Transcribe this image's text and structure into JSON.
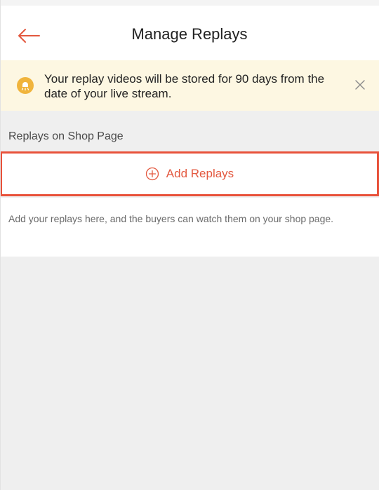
{
  "header": {
    "title": "Manage Replays"
  },
  "banner": {
    "text": "Your replay videos will be stored for 90 days from the date of your live stream.",
    "icon": "bell-icon"
  },
  "section": {
    "label": "Replays on Shop Page"
  },
  "add_button": {
    "label": "Add Replays"
  },
  "description": {
    "text": "Add your replays here, and the buyers can watch them on your shop page."
  },
  "colors": {
    "accent": "#e3583f",
    "banner_bg": "#fdf7e2",
    "banner_icon": "#f0b43c",
    "page_bg": "#efefef"
  }
}
